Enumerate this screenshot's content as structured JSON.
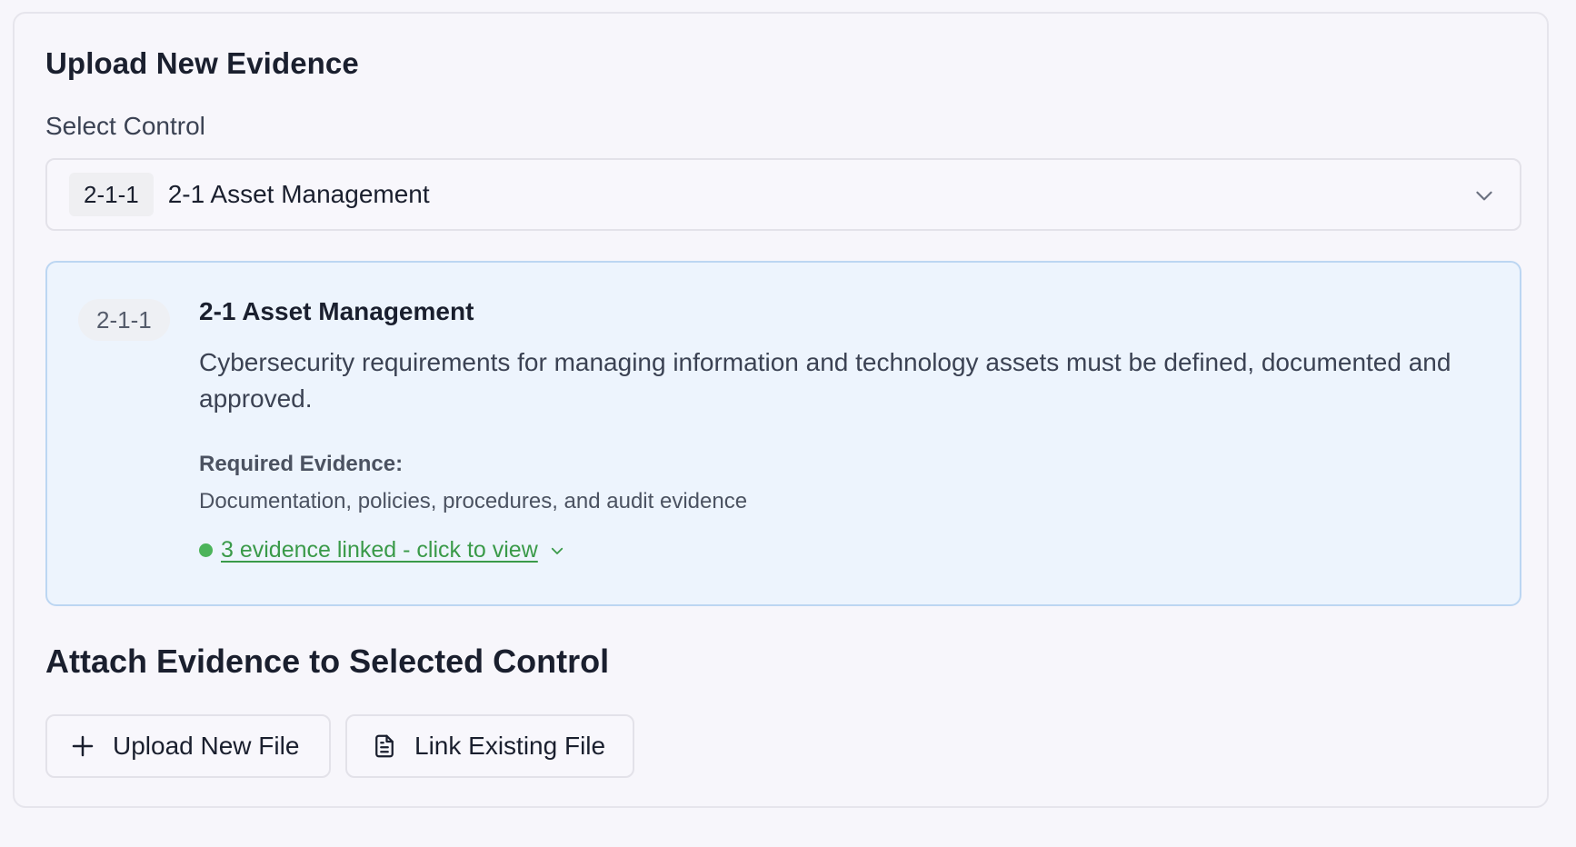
{
  "section": {
    "title": "Upload New Evidence",
    "select_label": "Select Control"
  },
  "control_select": {
    "code": "2-1-1",
    "value": "2-1 Asset Management",
    "icon": "chevron-down-icon"
  },
  "control_detail": {
    "code": "2-1-1",
    "title": "2-1 Asset Management",
    "description": "Cybersecurity requirements for managing information and technology assets must be defined, documented and approved.",
    "required_label": "Required Evidence:",
    "required_value": "Documentation, policies, procedures, and audit evidence",
    "evidence_link": "3 evidence linked - click to view",
    "status_color": "#4cb45a"
  },
  "attach": {
    "title": "Attach Evidence to Selected Control",
    "upload_label": "Upload New File",
    "upload_icon": "plus-icon",
    "link_label": "Link Existing File",
    "link_icon": "file-icon"
  }
}
